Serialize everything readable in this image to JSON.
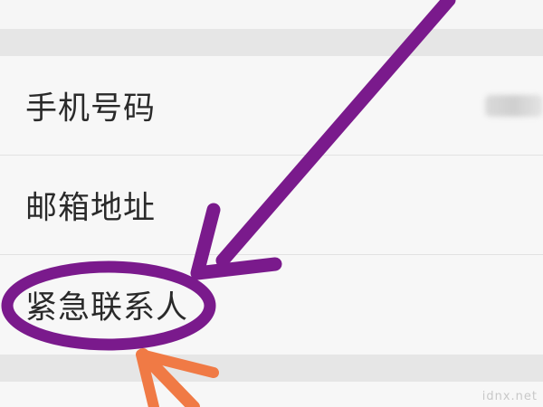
{
  "settings": {
    "rows": [
      {
        "label": "手机号码",
        "value_masked": true
      },
      {
        "label": "邮箱地址"
      },
      {
        "label": "紧急联系人",
        "highlighted": true
      }
    ]
  },
  "annotation": {
    "highlight_color": "#7a1a8c",
    "secondary_arrow_color": "#f07a45"
  },
  "watermark": "idnx.net"
}
